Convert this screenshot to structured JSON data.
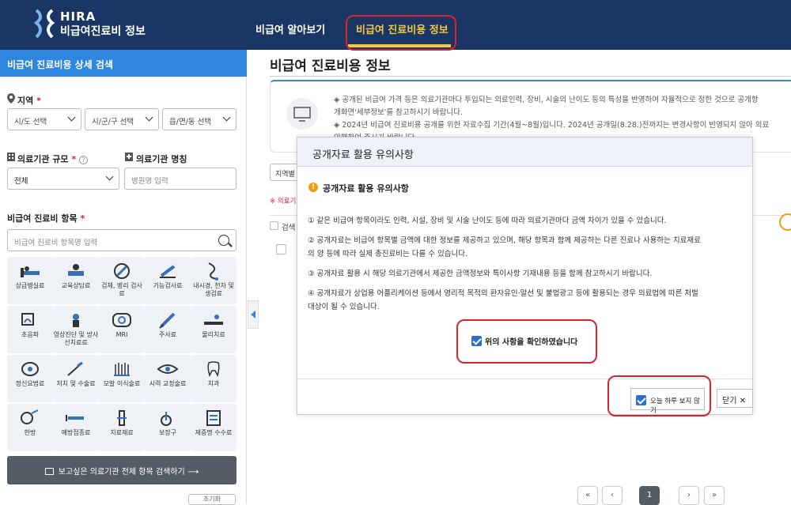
{
  "header": {
    "logo_line1": "HIRA",
    "logo_line2": "비급여진료비 정보",
    "nav": [
      "비급여 알아보기",
      "비급여 진료비용 정보"
    ]
  },
  "sidebar": {
    "title": "비급여 진료비용 상세 검색",
    "region_label": "지역",
    "region_selects": [
      "시/도 선택",
      "시/군/구 선택",
      "읍/면/동 선택"
    ],
    "scale_label": "의료기관 규모",
    "scale_value": "전체",
    "name_label": "의료기관 명칭",
    "name_placeholder": "병원명 입력",
    "items_label": "비급여 진료비 항목",
    "items_placeholder": "비급여 진료비 항목명 입력",
    "categories": [
      "상급병실료",
      "교육상담료",
      "검체, 병리 검사료",
      "기능검사료",
      "내시경, 천자 및 생검료",
      "초음파",
      "영상진단 및 방사선치료료",
      "MRI",
      "주사료",
      "물리치료",
      "정신요법료",
      "처치 및 수술료",
      "모발 이식술료",
      "시력 교정술료",
      "치과",
      "한방",
      "예방접종료",
      "치료재료",
      "보장구",
      "제증명 수수료"
    ],
    "search_all_button": "보고싶은 의료기관 전체 항목 검색하기",
    "reset_button": "초기화"
  },
  "main": {
    "title": "비급여 진료비용 정보",
    "info_lines": [
      "◈ 공개된 비급여 가격 등은 의료기관마다 투입되는 의료인력, 장비, 시술의 난이도 등의 특성을 반영하여 자율적으로 정한 것으로 공개항",
      "개화면'세부정보'를 참고하시기 바랍니다.",
      "◈ 2024년 비급여 진료비용 공개를 위한 자료수집 기간(4월~8월)입니다. 2024년 공개일(8.28.)전까지는 변경사항이 반영되지 않아 의료",
      "안해하여 주시기 바랍니다."
    ],
    "region_filter": "지역별",
    "note": "※ 의료기",
    "search_col": "검색",
    "pagination": {
      "current": "1"
    }
  },
  "modal": {
    "title": "공개자료 활용 유의사항",
    "subtitle": "공개자료 활용 유의사항",
    "p1": "① 같은 비급여 항목이라도 인력, 시설, 장비 및 시술 난이도 등에 따라 의료기관마다 금액 차이가 있을 수 있습니다.",
    "p2a": "② 공개자료는 비급여 항목별 금액에 대한 정보를 제공하고 있으며, 해당 항목과 함께 제공하는 다른 진료나 사용하는 치료재료",
    "p2b": "의 양 등에 따라 실제 총진료비는 다를 수 있습니다.",
    "p3": "③ 공개자료 활용 시 해당 의료기관에서 제공한 금액정보와 특이사항 기재내용 등을 함께 참고하시기 바랍니다.",
    "p4a": "④ 공개자료가 상업용 어플리케이션 등에서 영리적 목적의 환자유인·알선 및 불법광고 등에 활용되는 경우 의료법에 따른 처벌",
    "p4b": "대상이 될 수 있습니다.",
    "confirm_label": "위의 사항을 확인하였습니다",
    "noshow_label": "오늘 하루 보지 않기",
    "close_label": "닫기 ✕"
  },
  "colors": {
    "header_bg": "#1a3664",
    "accent": "#2e86de",
    "highlight": "#d9232f",
    "nav_active": "#f4c746"
  }
}
